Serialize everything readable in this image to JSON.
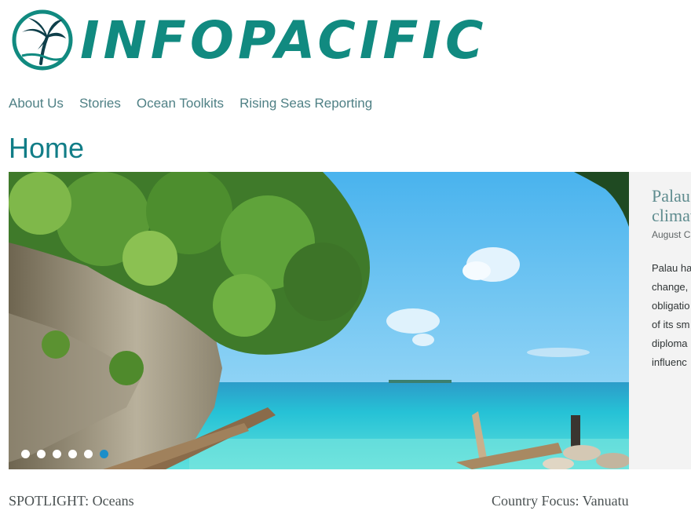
{
  "brand": {
    "name": "INFOPACIFIC",
    "color": "#118a80",
    "logo_icon": "palm-tree-icon"
  },
  "nav": {
    "items": [
      {
        "label": "About Us"
      },
      {
        "label": "Stories"
      },
      {
        "label": "Ocean Toolkits"
      },
      {
        "label": "Rising Seas Reporting"
      }
    ]
  },
  "page": {
    "title": "Home"
  },
  "slider": {
    "image_alt": "Tropical beach with rocky cliff, turquoise sea and driftwood",
    "slide": {
      "title": "Palau climate",
      "date": "August C",
      "excerpt": "Palau ha change, obligatio of its sm diploma influenc"
    },
    "dots_count": 6,
    "active_dot_index": 5,
    "active_dot_color": "#1d8ec9"
  },
  "sections": {
    "spotlight": "SPOTLIGHT: Oceans",
    "country_focus": "Country Focus: Vanuatu"
  }
}
